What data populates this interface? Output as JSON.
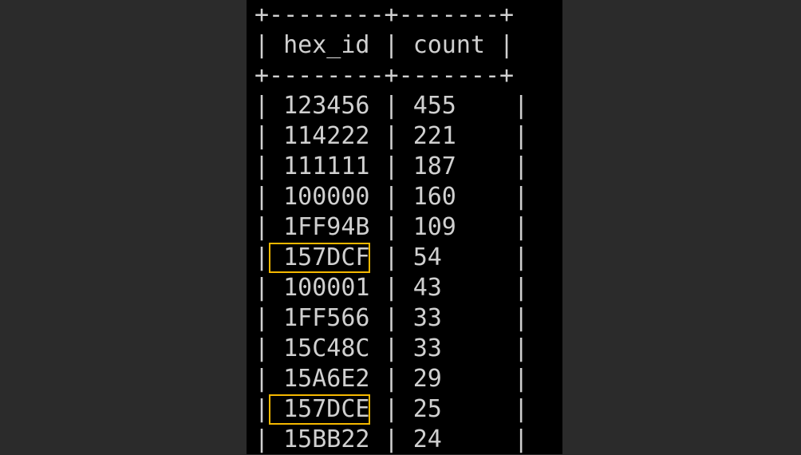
{
  "terminal": {
    "border_line": "+--------+-------+",
    "columns": [
      "hex_id",
      "count"
    ],
    "highlight_color": "#f5b800",
    "rows": [
      {
        "hex_id": "123456",
        "count": "455",
        "highlighted": false
      },
      {
        "hex_id": "114222",
        "count": "221",
        "highlighted": false
      },
      {
        "hex_id": "111111",
        "count": "187",
        "highlighted": false
      },
      {
        "hex_id": "100000",
        "count": "160",
        "highlighted": false
      },
      {
        "hex_id": "1FF94B",
        "count": "109",
        "highlighted": false
      },
      {
        "hex_id": "157DCF",
        "count": "54",
        "highlighted": true
      },
      {
        "hex_id": "100001",
        "count": "43",
        "highlighted": false
      },
      {
        "hex_id": "1FF566",
        "count": "33",
        "highlighted": false
      },
      {
        "hex_id": "15C48C",
        "count": "33",
        "highlighted": false
      },
      {
        "hex_id": "15A6E2",
        "count": "29",
        "highlighted": false
      },
      {
        "hex_id": "157DCE",
        "count": "25",
        "highlighted": true
      },
      {
        "hex_id": "15BB22",
        "count": "24",
        "highlighted": false
      }
    ]
  }
}
